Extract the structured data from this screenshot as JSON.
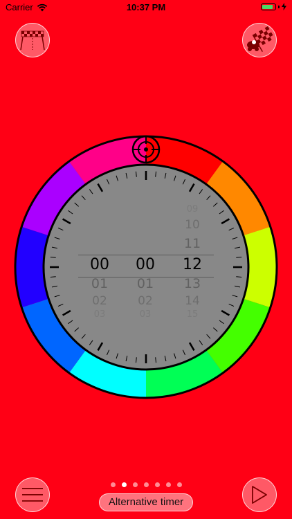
{
  "status_bar": {
    "carrier": "Carrier",
    "time": "10:37 PM",
    "battery_level": 0.9
  },
  "toolbar": {
    "finish_icon": "finish-flag-icon",
    "race_icon": "race-car-flag-icon"
  },
  "dial": {
    "ring_colors": [
      "#ff0000",
      "#ff8800",
      "#ccff00",
      "#44ff00",
      "#00ff55",
      "#00ffff",
      "#0066ff",
      "#2200ff",
      "#aa00ff",
      "#ff0088"
    ],
    "face_color": "#888888",
    "target_icon": "crosshair-icon"
  },
  "picker": {
    "hours": [
      "00",
      "01",
      "02",
      "03"
    ],
    "minutes": [
      "00",
      "01",
      "02",
      "03"
    ],
    "seconds": [
      "09",
      "10",
      "11",
      "12",
      "13",
      "14",
      "15"
    ]
  },
  "bottom": {
    "menu_icon": "hamburger-menu-icon",
    "play_icon": "play-icon",
    "page_count": 7,
    "active_page": 1,
    "alt_timer_label": "Alternative timer"
  }
}
